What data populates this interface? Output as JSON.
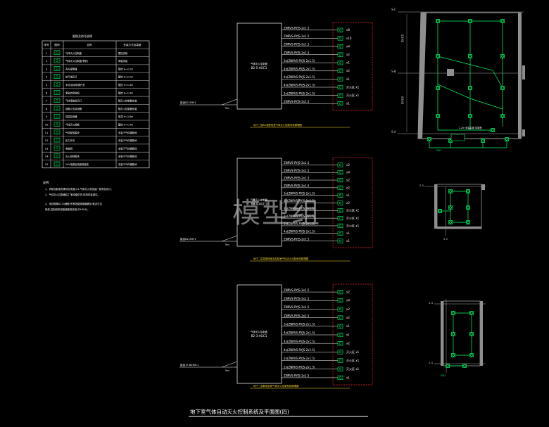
{
  "legend": {
    "title": "图例及符号说明",
    "headers": [
      "序号",
      "图例",
      "名称",
      "安装方式及高度"
    ],
    "rows": [
      {
        "no": "1",
        "name": "气体灭火控制盘",
        "install": "壁挂安装"
      },
      {
        "no": "2",
        "name": "气体灭火控制盘(警铃)",
        "install": "明装安装"
      },
      {
        "no": "3",
        "name": "声光报警器",
        "install": "壁挂 H=2.2m"
      },
      {
        "no": "4",
        "name": "放气指示灯",
        "install": "壁挂 H=2.2m"
      },
      {
        "no": "5",
        "name": "手动/自动转换开关",
        "install": "壁挂 H=1.4m"
      },
      {
        "no": "6",
        "name": "紧急启停按钮",
        "install": "壁挂 H=1.4m"
      },
      {
        "no": "7",
        "name": "气体喷放指示灯",
        "install": "随灭火控制器安装"
      },
      {
        "no": "8",
        "name": "感烟火灾探测器",
        "install": "随灭火控制器安装"
      },
      {
        "no": "9",
        "name": "感温探测器",
        "install": "吸顶 H=2.6m"
      },
      {
        "no": "10",
        "name": "气体灭火钢瓶",
        "install": "壁挂 H=1.4m"
      },
      {
        "no": "11",
        "name": "气体释放模块",
        "install": "安装于气体钢瓶间"
      },
      {
        "no": "12",
        "name": "压力开关",
        "install": "安装于气体钢瓶间"
      },
      {
        "no": "13",
        "name": "电磁阀",
        "install": "安装于气体钢瓶间"
      },
      {
        "no": "14",
        "name": "灭火控制模块",
        "install": "安装于气体钢瓶间"
      },
      {
        "no": "15",
        "name": "24V电源及电磁阀接线",
        "install": "安装于气体钢瓶间"
      }
    ]
  },
  "notes": {
    "title": "说明:",
    "lines": [
      "1、消防控制室布置详见电施-01,气体灭火系统由厂家深化设计。",
      "   2、气体灭火控制器由厂家成套供货,现场安装调试。",
      "2、电线穿管SC15暗敷,所有线路穿钢管敷设,就近引至",
      "   桥架,控制线采用阻燃型双绞线(ZR-RVS)。"
    ]
  },
  "panels": [
    {
      "panel_name": "气体灭火控制盘",
      "panel_code": "B2-5-AGC1",
      "input_label": "接自B2-SHF1",
      "len_label": "5m",
      "caption": "地下二层B2变配电室气体灭火控制系统原理图",
      "rows": [
        {
          "cable": "ZNRVS-RYJS-2x1.5",
          "count": "x8"
        },
        {
          "cable": "ZNRVS-RYJS-2x1.5",
          "count": "x10"
        },
        {
          "cable": "ZNRVS-RYJS-2x1.5",
          "count": "x4"
        },
        {
          "cable": "ZNRVS-RYJS-2x1.5",
          "count": "x2"
        },
        {
          "cable": "3x(ZNRVS-RYJS-2x1.5)",
          "count": "x1"
        },
        {
          "cable": "4x(ZNRVS-RYJS-2x1.5)",
          "count": "x2"
        },
        {
          "cable": "4x(ZNRVS-RYJS-2x1.5)",
          "count": "x1"
        },
        {
          "cable": "4x(ZNRVS-RYJS-2x1.5)",
          "count": "灭火区 x1"
        },
        {
          "cable": "2x(ZNRVS-RYJS-2x1.5)",
          "count": "灭火区 x1"
        },
        {
          "cable": "ZNRVS-RYJS-2x1.5",
          "count": "x1"
        }
      ]
    },
    {
      "panel_name": "气体灭火控制盘",
      "panel_code": "B2-4-AGC1",
      "input_label": "接自B2-SHF1",
      "len_label": "5m",
      "caption": "地下二层变配电室及控制室气体灭火控制系统原理图",
      "rows": [
        {
          "cable": "ZNRVS-RYJS-2x1.5",
          "count": "x2"
        },
        {
          "cable": "ZNRVS-RYJS-2x1.5",
          "count": "x4"
        },
        {
          "cable": "ZNRVS-RYJS-2x1.5",
          "count": "x2"
        },
        {
          "cable": "ZNRVS-RYJS-2x1.5",
          "count": "x2"
        },
        {
          "cable": "3x(ZNRVS-RYJS-2x1.5)",
          "count": "x1"
        },
        {
          "cable": "4x(ZNRVS-RYJS-2x1.5)",
          "count": "x2"
        },
        {
          "cable": "4x(ZNRVS-RYJS-2x1.5)",
          "count": "灭火区 x1"
        },
        {
          "cable": "2x(ZNRVS-RYJS-2x1.5)",
          "count": "灭火区 x1"
        },
        {
          "cable": "2x(ZNRVS-RYJS-2x1.5)",
          "count": "灭火区 x1"
        },
        {
          "cable": "4x(ZNRVS-RYJS-2x1.5)",
          "count": "x1"
        },
        {
          "cable": "ZNRVS-RYJS-2x1.5",
          "count": "x1"
        }
      ]
    },
    {
      "panel_name": "气体灭火控制盘",
      "panel_code": "B2-3-AGC1",
      "input_label": "接自1F-B2MX-1",
      "len_label": "5m",
      "caption": "地下二层弱电机房气体灭火控制系统原理图",
      "rows": [
        {
          "cable": "ZNRVS-RYJS-2x1.5",
          "count": "x2"
        },
        {
          "cable": "ZNRVS-RYJS-2x1.5",
          "count": "x4"
        },
        {
          "cable": "ZNRVS-RYJS-2x1.5",
          "count": "x2"
        },
        {
          "cable": "ZNRVS-RYJS-2x1.5",
          "count": "x2"
        },
        {
          "cable": "3x(ZNRVS-RYJS-2x1.5)",
          "count": "x1"
        },
        {
          "cable": "4x(ZNRVS-RYJS-2x1.5)",
          "count": "x1"
        },
        {
          "cable": "4x(ZNRVS-RYJS-2x1.5)",
          "count": "x2"
        },
        {
          "cable": "4x(ZNRVS-RYJS-2x1.5)",
          "count": "灭火区 x1"
        },
        {
          "cable": "2x(ZNRVS-RYJS-2x1.5)",
          "count": "灭火区 x1"
        },
        {
          "cable": "2x(ZNRVS-RYJS-2x1.5)",
          "count": "灭火区 x1"
        },
        {
          "cable": "ZNRVS-RYJS-2x1.5",
          "count": "x1"
        }
      ]
    }
  ],
  "plans": {
    "grid_top": [
      "S-C",
      "S-B",
      "S-A"
    ],
    "dims": [
      "8400",
      "8400"
    ],
    "small_grid": [
      "S-5",
      "S-5",
      "S-4",
      "S-4"
    ],
    "tags": [
      "GA1",
      "GA1"
    ],
    "room_note": "2.2m 安装高度 控制盘"
  },
  "watermark": "模型组",
  "drawing_title": "地下室气体自动灭火控制系统及平面图(四)",
  "colors": {
    "background": "#000000",
    "line_white": "#ffffff",
    "wire_green": "#00ff66",
    "dashed_red": "#ff2a2a",
    "caption_yellow": "#ffdf33",
    "wall_gray": "#8f8f8f",
    "grid_axis": "#cccccc"
  }
}
